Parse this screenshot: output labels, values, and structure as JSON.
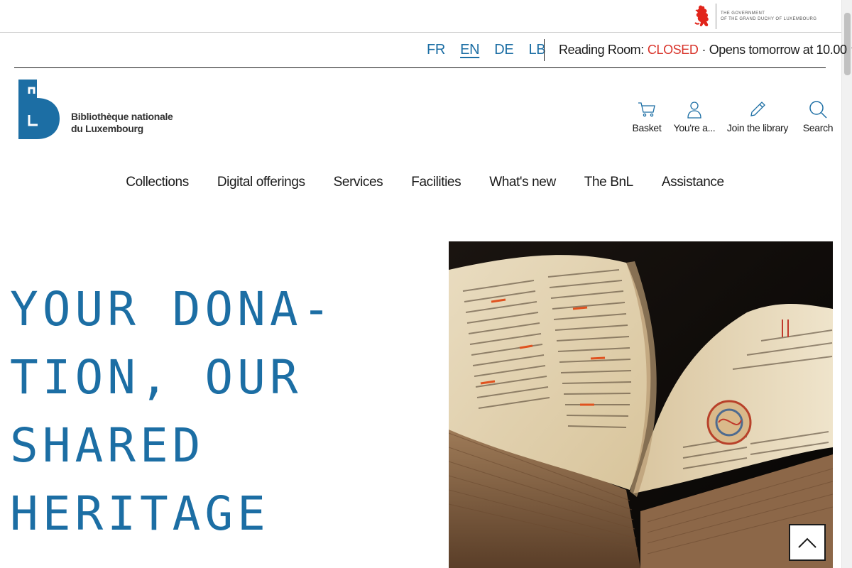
{
  "government": {
    "line1": "THE GOVERNMENT",
    "line2": "OF THE GRAND DUCHY OF LUXEMBOURG",
    "logo_icon": "red-lion-icon",
    "brand_color": "#e1251b"
  },
  "languages": [
    {
      "label": "FR",
      "active": false
    },
    {
      "label": "EN",
      "active": true
    },
    {
      "label": "DE",
      "active": false
    },
    {
      "label": "LB",
      "active": false
    }
  ],
  "reading_room": {
    "label": "Reading Room:",
    "status": "CLOSED",
    "detail": "· Opens tomorrow at 10.00",
    "status_color": "#d9342b"
  },
  "header": {
    "logo_line1": "Bibliothèque nationale",
    "logo_line2": "du Luxembourg",
    "brand_color": "#1c6ea4",
    "tools": [
      {
        "label": "Basket",
        "icon": "basket-icon"
      },
      {
        "label": "You're a...",
        "icon": "user-icon"
      },
      {
        "label": "Join the library",
        "icon": "pencil-icon"
      },
      {
        "label": "Search",
        "icon": "search-icon"
      }
    ]
  },
  "nav": {
    "items": [
      "Collections",
      "Digital offerings",
      "Services",
      "Facilities",
      "What's new",
      "The BnL",
      "Assistance"
    ]
  },
  "hero": {
    "title_lines": [
      "YOUR DONA-",
      "TION, OUR",
      "SHARED",
      "HERITAGE"
    ],
    "image_alt": "manuscript-book-image"
  },
  "scroll_top": {
    "icon": "chevron-up-icon"
  }
}
